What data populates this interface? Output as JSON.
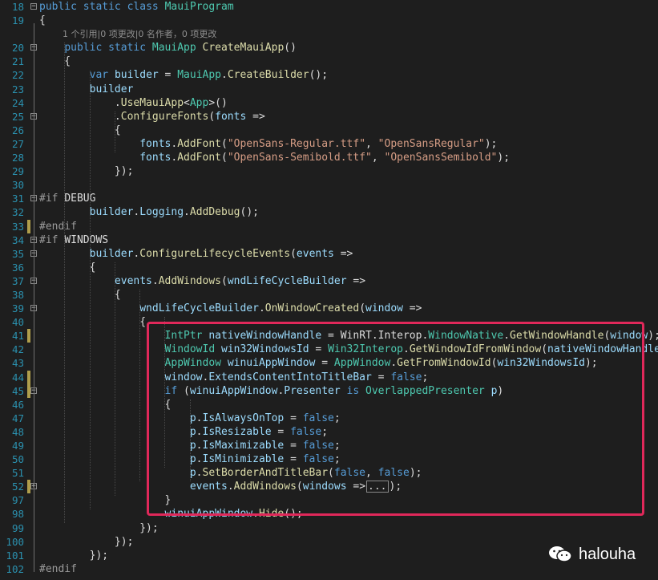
{
  "codelens": "1 个引用|0 项更改|0 名作者，0 项更改",
  "watermark": "halouha",
  "lines": [
    {
      "n": "18",
      "fold": "minus",
      "chg": false,
      "tokens": [
        [
          "kw",
          "public "
        ],
        [
          "kw",
          "static "
        ],
        [
          "kw",
          "class "
        ],
        [
          "ty",
          "MauiProgram"
        ]
      ]
    },
    {
      "n": "19",
      "fold": "",
      "chg": false,
      "tokens": [
        [
          "plain",
          "{"
        ]
      ]
    },
    {
      "n": "",
      "lens": true
    },
    {
      "n": "20",
      "fold": "minus",
      "chg": false,
      "tokens": [
        [
          "plain",
          "    "
        ],
        [
          "kw",
          "public "
        ],
        [
          "kw",
          "static "
        ],
        [
          "ty",
          "MauiApp "
        ],
        [
          "fn",
          "CreateMauiApp"
        ],
        [
          "plain",
          "()"
        ]
      ]
    },
    {
      "n": "21",
      "fold": "",
      "chg": false,
      "tokens": [
        [
          "plain",
          "    {"
        ]
      ]
    },
    {
      "n": "22",
      "fold": "",
      "chg": false,
      "tokens": [
        [
          "plain",
          "        "
        ],
        [
          "kw",
          "var "
        ],
        [
          "var",
          "builder"
        ],
        [
          "plain",
          " = "
        ],
        [
          "ty",
          "MauiApp"
        ],
        [
          "plain",
          "."
        ],
        [
          "fn",
          "CreateBuilder"
        ],
        [
          "plain",
          "();"
        ]
      ]
    },
    {
      "n": "23",
      "fold": "",
      "chg": false,
      "tokens": [
        [
          "plain",
          "        "
        ],
        [
          "var",
          "builder"
        ]
      ]
    },
    {
      "n": "24",
      "fold": "",
      "chg": false,
      "tokens": [
        [
          "plain",
          "            ."
        ],
        [
          "fn",
          "UseMauiApp"
        ],
        [
          "plain",
          "<"
        ],
        [
          "ty",
          "App"
        ],
        [
          "plain",
          ">()"
        ]
      ]
    },
    {
      "n": "25",
      "fold": "minus",
      "chg": false,
      "tokens": [
        [
          "plain",
          "            ."
        ],
        [
          "fn",
          "ConfigureFonts"
        ],
        [
          "plain",
          "("
        ],
        [
          "var",
          "fonts"
        ],
        [
          "plain",
          " =>"
        ]
      ]
    },
    {
      "n": "26",
      "fold": "",
      "chg": false,
      "tokens": [
        [
          "plain",
          "            {"
        ]
      ]
    },
    {
      "n": "27",
      "fold": "",
      "chg": false,
      "tokens": [
        [
          "plain",
          "                "
        ],
        [
          "var",
          "fonts"
        ],
        [
          "plain",
          "."
        ],
        [
          "fn",
          "AddFont"
        ],
        [
          "plain",
          "("
        ],
        [
          "str",
          "\"OpenSans-Regular.ttf\""
        ],
        [
          "plain",
          ", "
        ],
        [
          "str",
          "\"OpenSansRegular\""
        ],
        [
          "plain",
          ");"
        ]
      ]
    },
    {
      "n": "28",
      "fold": "",
      "chg": false,
      "tokens": [
        [
          "plain",
          "                "
        ],
        [
          "var",
          "fonts"
        ],
        [
          "plain",
          "."
        ],
        [
          "fn",
          "AddFont"
        ],
        [
          "plain",
          "("
        ],
        [
          "str",
          "\"OpenSans-Semibold.ttf\""
        ],
        [
          "plain",
          ", "
        ],
        [
          "str",
          "\"OpenSansSemibold\""
        ],
        [
          "plain",
          ");"
        ]
      ]
    },
    {
      "n": "29",
      "fold": "",
      "chg": false,
      "tokens": [
        [
          "plain",
          "            });"
        ]
      ]
    },
    {
      "n": "30",
      "fold": "",
      "chg": false,
      "tokens": []
    },
    {
      "n": "31",
      "fold": "minus",
      "chg": false,
      "tokens": [
        [
          "pre",
          "#if "
        ],
        [
          "plain",
          "DEBUG"
        ]
      ]
    },
    {
      "n": "32",
      "fold": "",
      "chg": false,
      "tokens": [
        [
          "plain",
          "        "
        ],
        [
          "var",
          "builder"
        ],
        [
          "plain",
          "."
        ],
        [
          "var",
          "Logging"
        ],
        [
          "plain",
          "."
        ],
        [
          "fn",
          "AddDebug"
        ],
        [
          "plain",
          "();"
        ]
      ]
    },
    {
      "n": "33",
      "fold": "",
      "chg": true,
      "tokens": [
        [
          "pre",
          "#endif"
        ]
      ]
    },
    {
      "n": "34",
      "fold": "minus",
      "chg": false,
      "tokens": [
        [
          "pre",
          "#if "
        ],
        [
          "plain",
          "WINDOWS"
        ]
      ]
    },
    {
      "n": "35",
      "fold": "minus",
      "chg": false,
      "tokens": [
        [
          "plain",
          "        "
        ],
        [
          "var",
          "builder"
        ],
        [
          "plain",
          "."
        ],
        [
          "fn",
          "ConfigureLifecycleEvents"
        ],
        [
          "plain",
          "("
        ],
        [
          "var",
          "events"
        ],
        [
          "plain",
          " =>"
        ]
      ]
    },
    {
      "n": "36",
      "fold": "",
      "chg": false,
      "tokens": [
        [
          "plain",
          "        {"
        ]
      ]
    },
    {
      "n": "37",
      "fold": "minus",
      "chg": false,
      "tokens": [
        [
          "plain",
          "            "
        ],
        [
          "var",
          "events"
        ],
        [
          "plain",
          "."
        ],
        [
          "fn",
          "AddWindows"
        ],
        [
          "plain",
          "("
        ],
        [
          "var",
          "wndLifeCycleBuilder"
        ],
        [
          "plain",
          " =>"
        ]
      ]
    },
    {
      "n": "38",
      "fold": "",
      "chg": false,
      "tokens": [
        [
          "plain",
          "            {"
        ]
      ]
    },
    {
      "n": "39",
      "fold": "minus",
      "chg": false,
      "tokens": [
        [
          "plain",
          "                "
        ],
        [
          "var",
          "wndLifeCycleBuilder"
        ],
        [
          "plain",
          "."
        ],
        [
          "fn",
          "OnWindowCreated"
        ],
        [
          "plain",
          "("
        ],
        [
          "var",
          "window"
        ],
        [
          "plain",
          " =>"
        ]
      ]
    },
    {
      "n": "40",
      "fold": "",
      "chg": false,
      "tokens": [
        [
          "plain",
          "                {"
        ]
      ]
    },
    {
      "n": "41",
      "fold": "",
      "chg": true,
      "tokens": [
        [
          "plain",
          "                    "
        ],
        [
          "ty",
          "IntPtr "
        ],
        [
          "var",
          "nativeWindowHandle"
        ],
        [
          "plain",
          " = "
        ],
        [
          "plain",
          "WinRT.Interop."
        ],
        [
          "ty",
          "WindowNative"
        ],
        [
          "plain",
          "."
        ],
        [
          "fn",
          "GetWindowHandle"
        ],
        [
          "plain",
          "("
        ],
        [
          "var",
          "window"
        ],
        [
          "plain",
          ");"
        ]
      ]
    },
    {
      "n": "42",
      "fold": "",
      "chg": false,
      "tokens": [
        [
          "plain",
          "                    "
        ],
        [
          "ty",
          "WindowId "
        ],
        [
          "var",
          "win32WindowsId"
        ],
        [
          "plain",
          " = "
        ],
        [
          "ty",
          "Win32Interop"
        ],
        [
          "plain",
          "."
        ],
        [
          "fn",
          "GetWindowIdFromWindow"
        ],
        [
          "plain",
          "("
        ],
        [
          "var",
          "nativeWindowHandle"
        ],
        [
          "plain",
          ");"
        ]
      ]
    },
    {
      "n": "43",
      "fold": "",
      "chg": false,
      "tokens": [
        [
          "plain",
          "                    "
        ],
        [
          "ty",
          "AppWindow "
        ],
        [
          "var",
          "winuiAppWindow"
        ],
        [
          "plain",
          " = "
        ],
        [
          "ty",
          "AppWindow"
        ],
        [
          "plain",
          "."
        ],
        [
          "fn",
          "GetFromWindowId"
        ],
        [
          "plain",
          "("
        ],
        [
          "var",
          "win32WindowsId"
        ],
        [
          "plain",
          ");"
        ]
      ]
    },
    {
      "n": "44",
      "fold": "",
      "chg": true,
      "tokens": [
        [
          "plain",
          "                    "
        ],
        [
          "var",
          "window"
        ],
        [
          "plain",
          "."
        ],
        [
          "var",
          "ExtendsContentIntoTitleBar"
        ],
        [
          "plain",
          " = "
        ],
        [
          "kw",
          "false"
        ],
        [
          "plain",
          ";"
        ]
      ]
    },
    {
      "n": "45",
      "fold": "minus",
      "chg": true,
      "tokens": [
        [
          "plain",
          "                    "
        ],
        [
          "kw",
          "if "
        ],
        [
          "plain",
          "("
        ],
        [
          "var",
          "winuiAppWindow"
        ],
        [
          "plain",
          "."
        ],
        [
          "var",
          "Presenter"
        ],
        [
          "plain",
          " "
        ],
        [
          "kw",
          "is "
        ],
        [
          "ty",
          "OverlappedPresenter "
        ],
        [
          "var",
          "p"
        ],
        [
          "plain",
          ")"
        ]
      ]
    },
    {
      "n": "46",
      "fold": "",
      "chg": false,
      "tokens": [
        [
          "plain",
          "                    {"
        ]
      ]
    },
    {
      "n": "47",
      "fold": "",
      "chg": false,
      "tokens": [
        [
          "plain",
          "                        "
        ],
        [
          "var",
          "p"
        ],
        [
          "plain",
          "."
        ],
        [
          "var",
          "IsAlwaysOnTop"
        ],
        [
          "plain",
          " = "
        ],
        [
          "kw",
          "false"
        ],
        [
          "plain",
          ";"
        ]
      ]
    },
    {
      "n": "48",
      "fold": "",
      "chg": false,
      "tokens": [
        [
          "plain",
          "                        "
        ],
        [
          "var",
          "p"
        ],
        [
          "plain",
          "."
        ],
        [
          "var",
          "IsResizable"
        ],
        [
          "plain",
          " = "
        ],
        [
          "kw",
          "false"
        ],
        [
          "plain",
          ";"
        ]
      ]
    },
    {
      "n": "49",
      "fold": "",
      "chg": false,
      "tokens": [
        [
          "plain",
          "                        "
        ],
        [
          "var",
          "p"
        ],
        [
          "plain",
          "."
        ],
        [
          "var",
          "IsMaximizable"
        ],
        [
          "plain",
          " = "
        ],
        [
          "kw",
          "false"
        ],
        [
          "plain",
          ";"
        ]
      ]
    },
    {
      "n": "50",
      "fold": "",
      "chg": false,
      "tokens": [
        [
          "plain",
          "                        "
        ],
        [
          "var",
          "p"
        ],
        [
          "plain",
          "."
        ],
        [
          "var",
          "IsMinimizable"
        ],
        [
          "plain",
          " = "
        ],
        [
          "kw",
          "false"
        ],
        [
          "plain",
          ";"
        ]
      ]
    },
    {
      "n": "51",
      "fold": "",
      "chg": false,
      "tokens": [
        [
          "plain",
          "                        "
        ],
        [
          "var",
          "p"
        ],
        [
          "plain",
          "."
        ],
        [
          "fn",
          "SetBorderAndTitleBar"
        ],
        [
          "plain",
          "("
        ],
        [
          "kw",
          "false"
        ],
        [
          "plain",
          ", "
        ],
        [
          "kw",
          "false"
        ],
        [
          "plain",
          ");"
        ]
      ]
    },
    {
      "n": "52",
      "fold": "plus",
      "chg": true,
      "tokens": [
        [
          "plain",
          "                        "
        ],
        [
          "var",
          "events"
        ],
        [
          "plain",
          "."
        ],
        [
          "fn",
          "AddWindows"
        ],
        [
          "plain",
          "("
        ],
        [
          "var",
          "windows"
        ],
        [
          "plain",
          " =>"
        ],
        [
          "ellipsis",
          "..."
        ],
        [
          "plain",
          ");"
        ]
      ]
    },
    {
      "n": "97",
      "fold": "",
      "chg": false,
      "tokens": [
        [
          "plain",
          "                    }"
        ]
      ]
    },
    {
      "n": "98",
      "fold": "",
      "chg": false,
      "tokens": [
        [
          "plain",
          "                    "
        ],
        [
          "var",
          "winuiAppWindow"
        ],
        [
          "plain",
          "."
        ],
        [
          "fn",
          "Hide"
        ],
        [
          "plain",
          "();"
        ]
      ]
    },
    {
      "n": "99",
      "fold": "",
      "chg": false,
      "tokens": [
        [
          "plain",
          "                });"
        ]
      ]
    },
    {
      "n": "100",
      "fold": "",
      "chg": false,
      "tokens": [
        [
          "plain",
          "            });"
        ]
      ]
    },
    {
      "n": "101",
      "fold": "",
      "chg": false,
      "tokens": [
        [
          "plain",
          "        });"
        ]
      ]
    },
    {
      "n": "102",
      "fold": "",
      "chg": false,
      "tokens": [
        [
          "pre",
          "#endif"
        ]
      ]
    }
  ]
}
